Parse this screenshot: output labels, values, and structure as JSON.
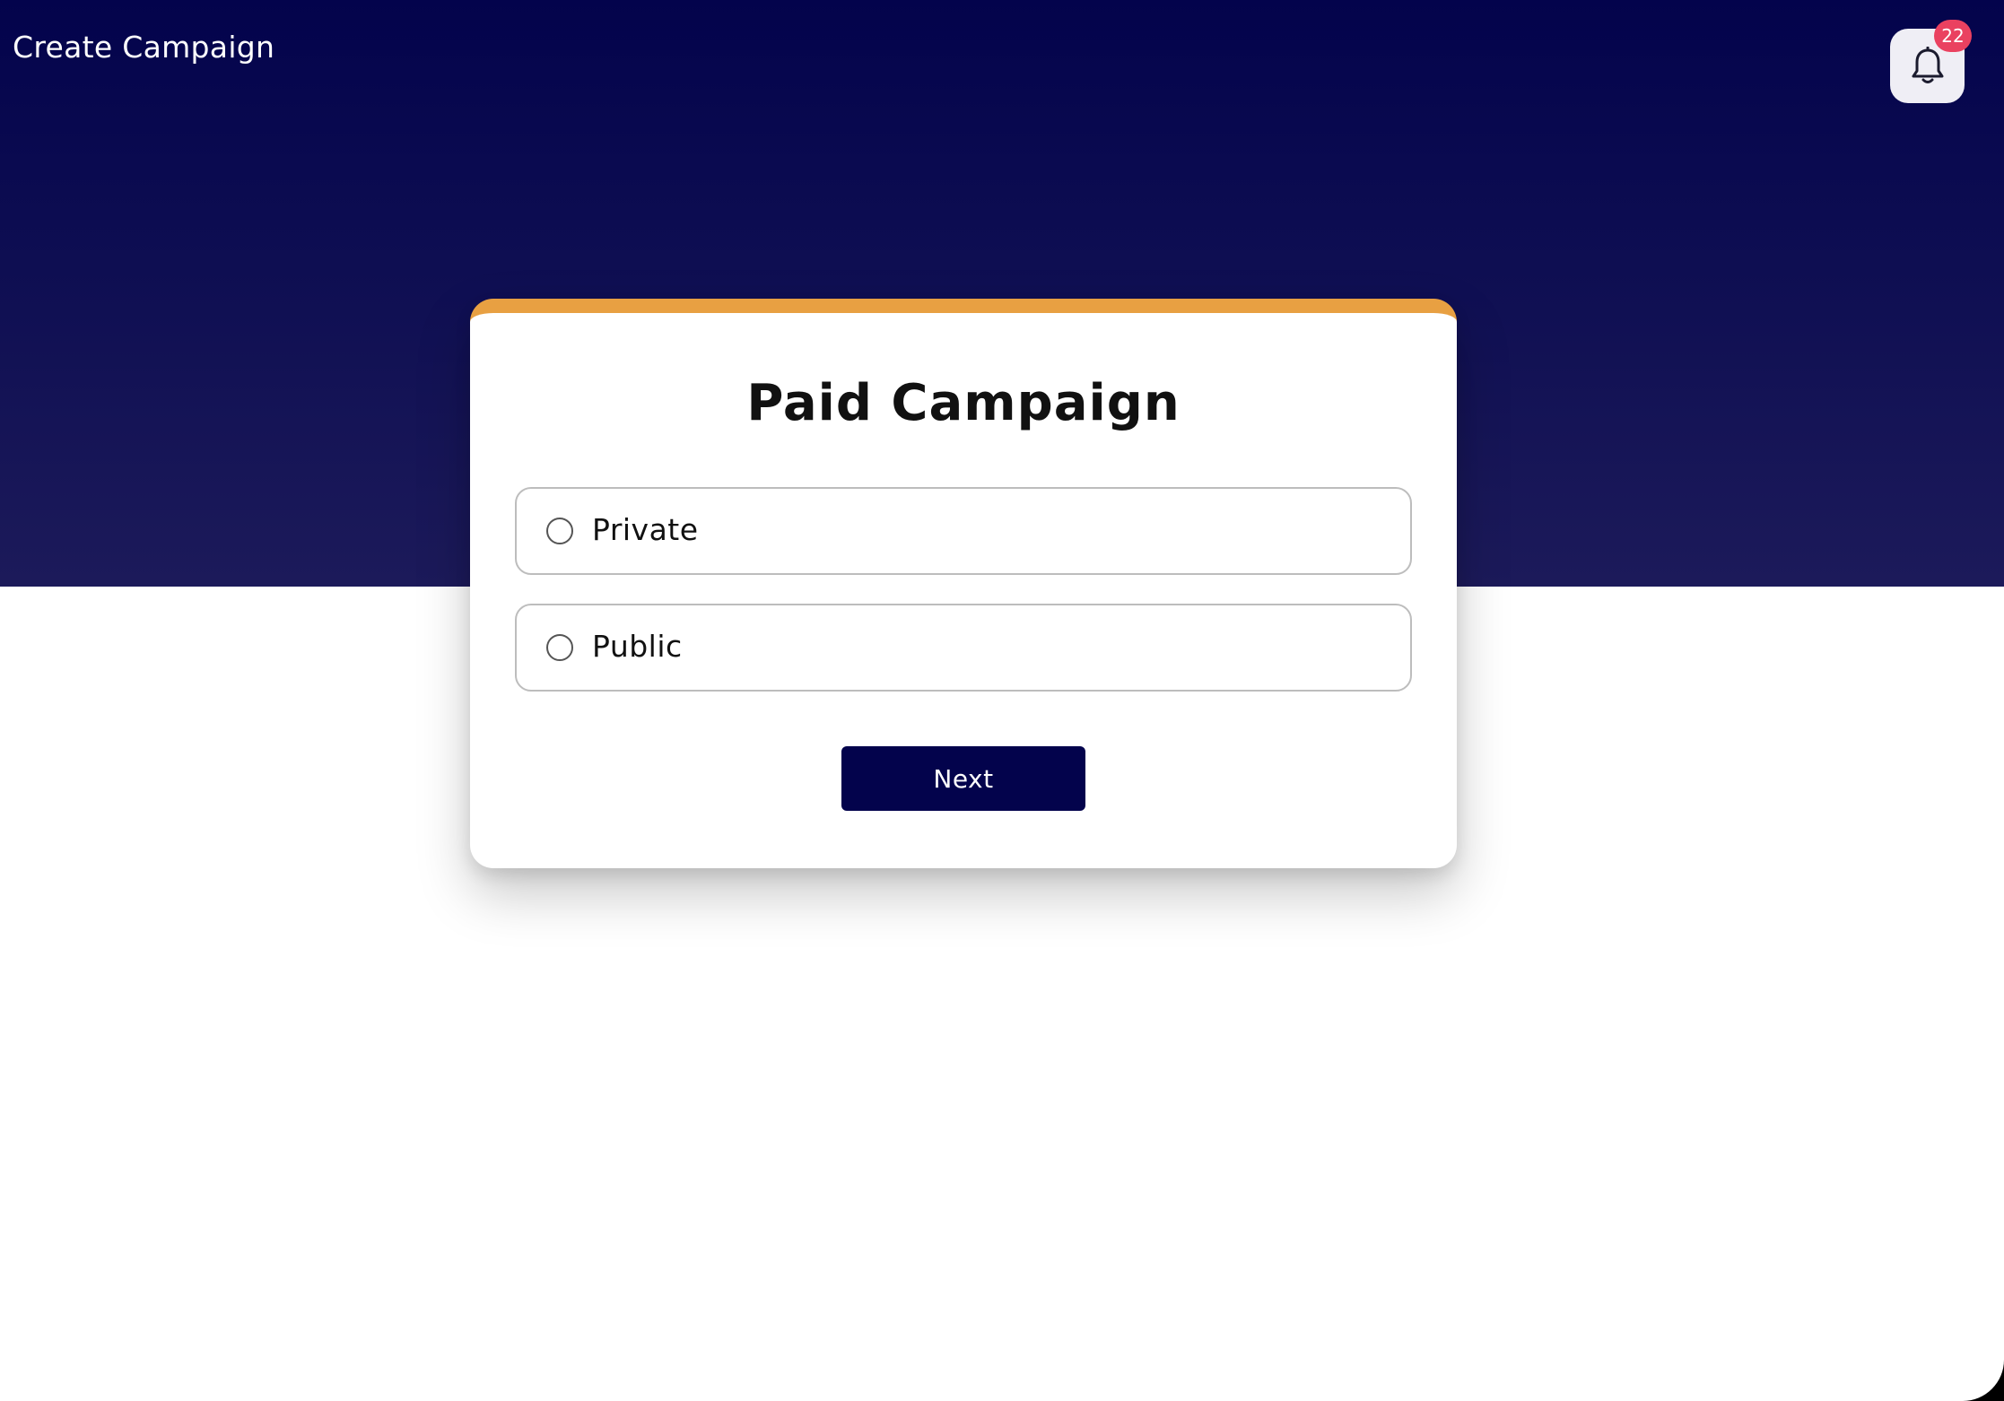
{
  "header": {
    "title": "Create Campaign",
    "notifications": {
      "icon": "bell-icon",
      "count": "22"
    }
  },
  "card": {
    "title": "Paid Campaign",
    "options": [
      {
        "label": "Private",
        "selected": false
      },
      {
        "label": "Public",
        "selected": false
      }
    ],
    "next_label": "Next"
  },
  "colors": {
    "header_bg": "#03034c",
    "accent_bar": "#e8a042",
    "primary_button": "#03034c",
    "badge": "#ea4160"
  }
}
